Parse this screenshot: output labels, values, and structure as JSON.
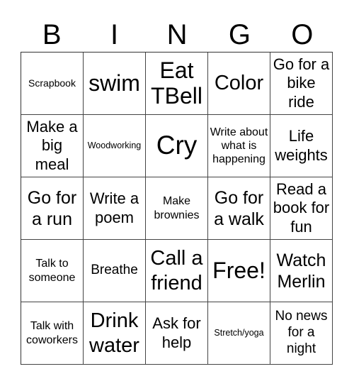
{
  "header": [
    "B",
    "I",
    "N",
    "G",
    "O"
  ],
  "cells": [
    "Scrapbook",
    "swim",
    "Eat TBell",
    "Color",
    "Go for a bike ride",
    "Make a big meal",
    "Woodworking",
    "Cry",
    "Write about what is happening",
    "Life weights",
    "Go for a run",
    "Write a poem",
    "Make brownies",
    "Go for a walk",
    "Read a book for fun",
    "Talk to someone",
    "Breathe",
    "Call a friend",
    "Free!",
    "Watch Merlin",
    "Talk with coworkers",
    "Drink water",
    "Ask for help",
    "Stretch/yoga",
    "No news for a night"
  ]
}
